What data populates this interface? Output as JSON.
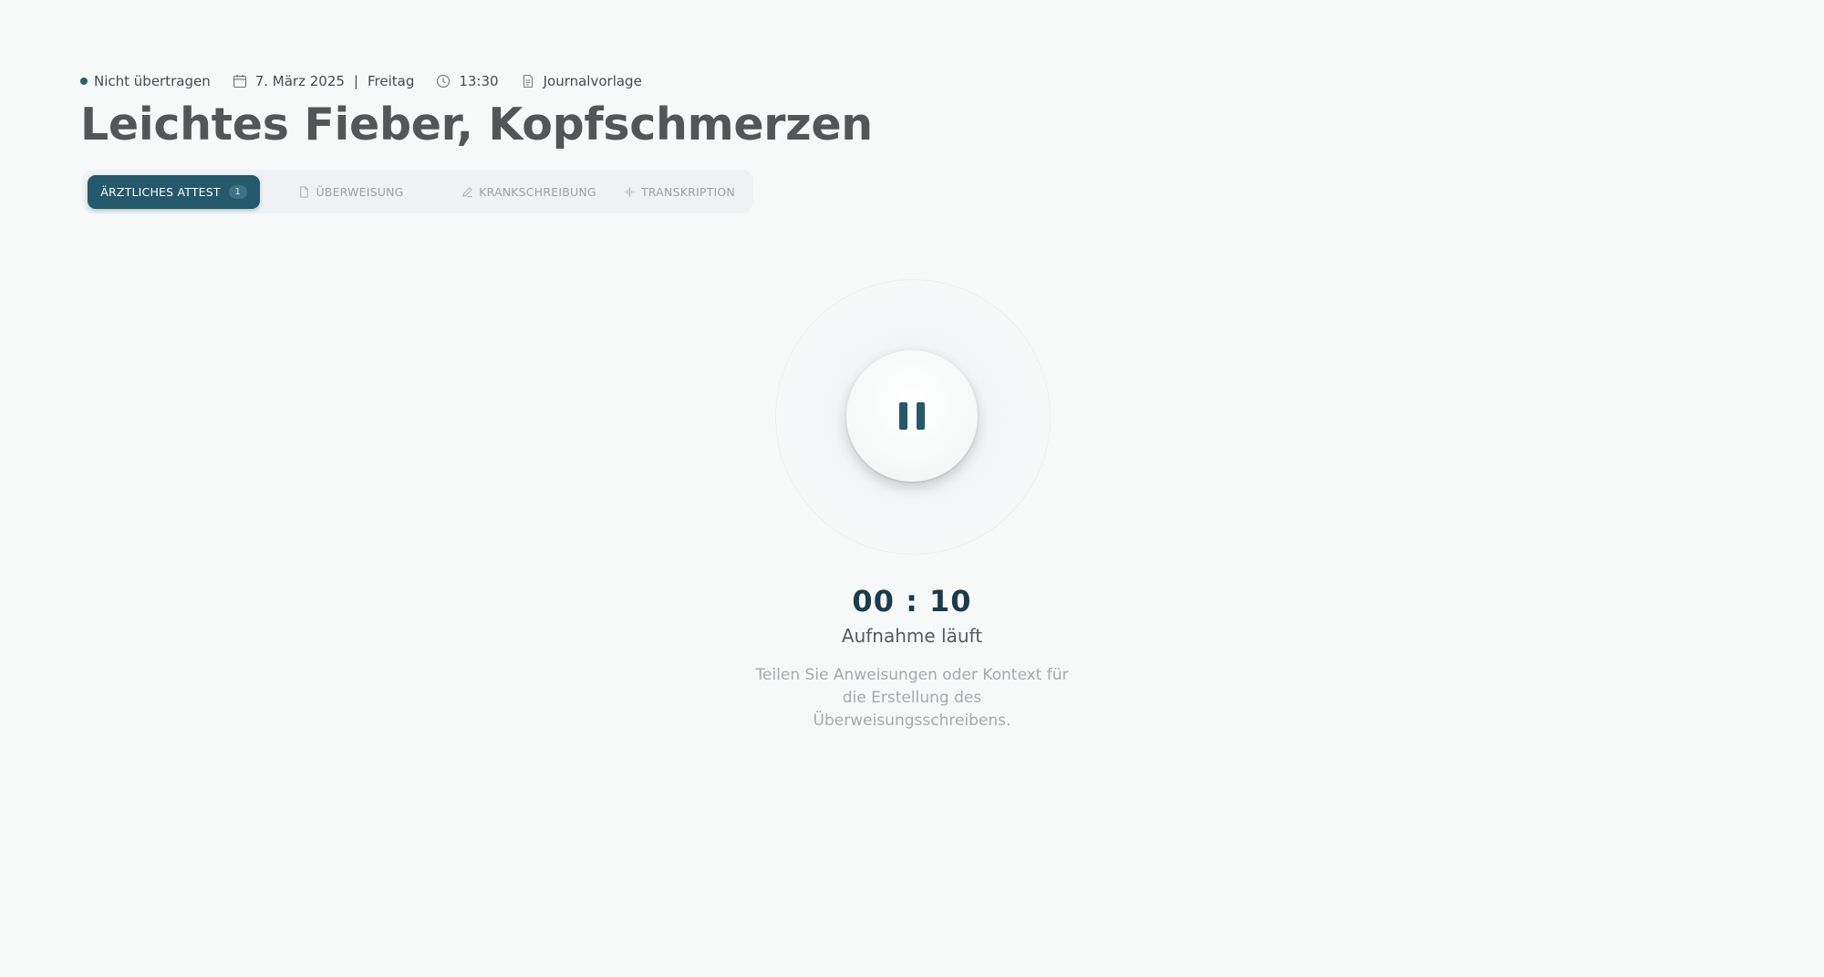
{
  "meta": {
    "status": "Nicht übertragen",
    "date": "7. März 2025",
    "date_separator": "|",
    "weekday": "Freitag",
    "time": "13:30",
    "template": "Journalvorlage"
  },
  "title": "Leichtes Fieber, Kopfschmerzen",
  "tabs": [
    {
      "label": "ÄRZTLICHES ATTEST",
      "badge": "1",
      "active": true
    },
    {
      "label": "ÜBERWEISUNG",
      "icon": "document-icon"
    },
    {
      "label": "KRANKSCHREIBUNG",
      "icon": "pencil-icon"
    },
    {
      "label": "TRANSKRIPTION",
      "icon": "waveform-icon"
    }
  ],
  "recorder": {
    "timer": "00 : 10",
    "status": "Aufnahme läuft",
    "hint": "Teilen Sie Anweisungen oder Kontext für die Erstellung des Überweisungsschreibens.",
    "control_icon": "pause-icon"
  },
  "colors": {
    "accent": "#23596a",
    "timer": "#183c4a",
    "background": "#f7f9f9"
  }
}
